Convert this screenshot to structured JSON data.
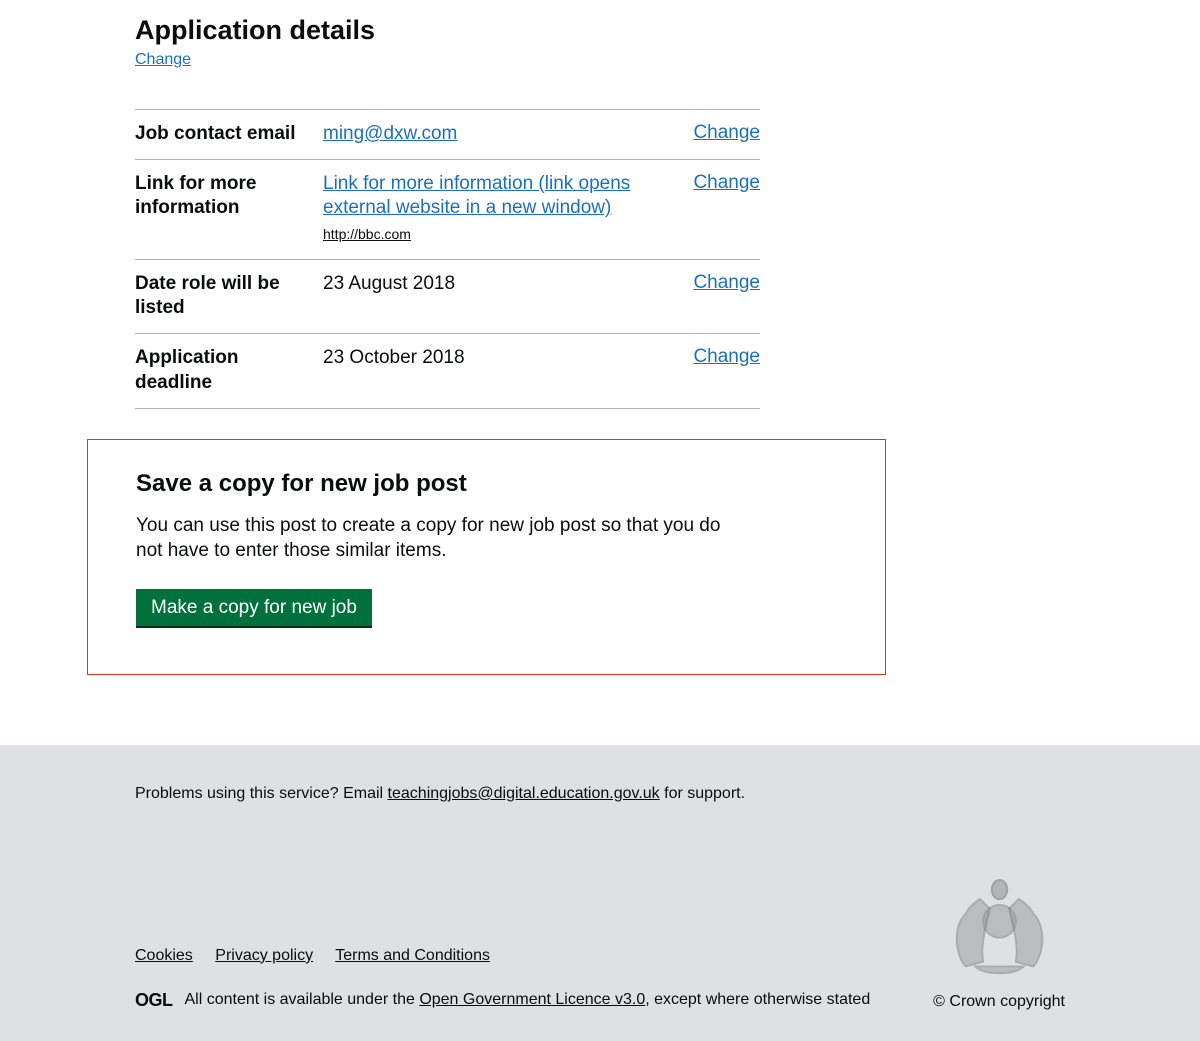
{
  "section": {
    "heading": "Application details",
    "change_label": "Change"
  },
  "rows": [
    {
      "key": "Job contact email",
      "value_link": "ming@dxw.com",
      "action": "Change"
    },
    {
      "key": "Link for more information",
      "value_link": "Link for more information (link opens external website in a new window) ",
      "url": "http://bbc.com",
      "action": "Change"
    },
    {
      "key": "Date role will be listed",
      "value": "23 August 2018",
      "action": "Change"
    },
    {
      "key": "Application deadline",
      "value": "23 October 2018",
      "action": "Change"
    }
  ],
  "copy": {
    "heading": "Save a copy for new job post",
    "text": "You can use this post to create a copy for new job post so that you do not have to enter those similar items.",
    "button": "Make a copy for new job"
  },
  "footer": {
    "support_prefix": "Problems using this service? Email ",
    "support_email": "teachingjobs@digital.education.gov.uk",
    "support_suffix": " for support.",
    "links": {
      "cookies": "Cookies",
      "privacy": "Privacy policy",
      "terms": "Terms and Conditions"
    },
    "ogl_label": "OGL",
    "licence_prefix": "All content is available under the ",
    "licence_link": "Open Government Licence v3.0",
    "licence_suffix": ", except where otherwise stated",
    "copyright": "© Crown copyright"
  }
}
